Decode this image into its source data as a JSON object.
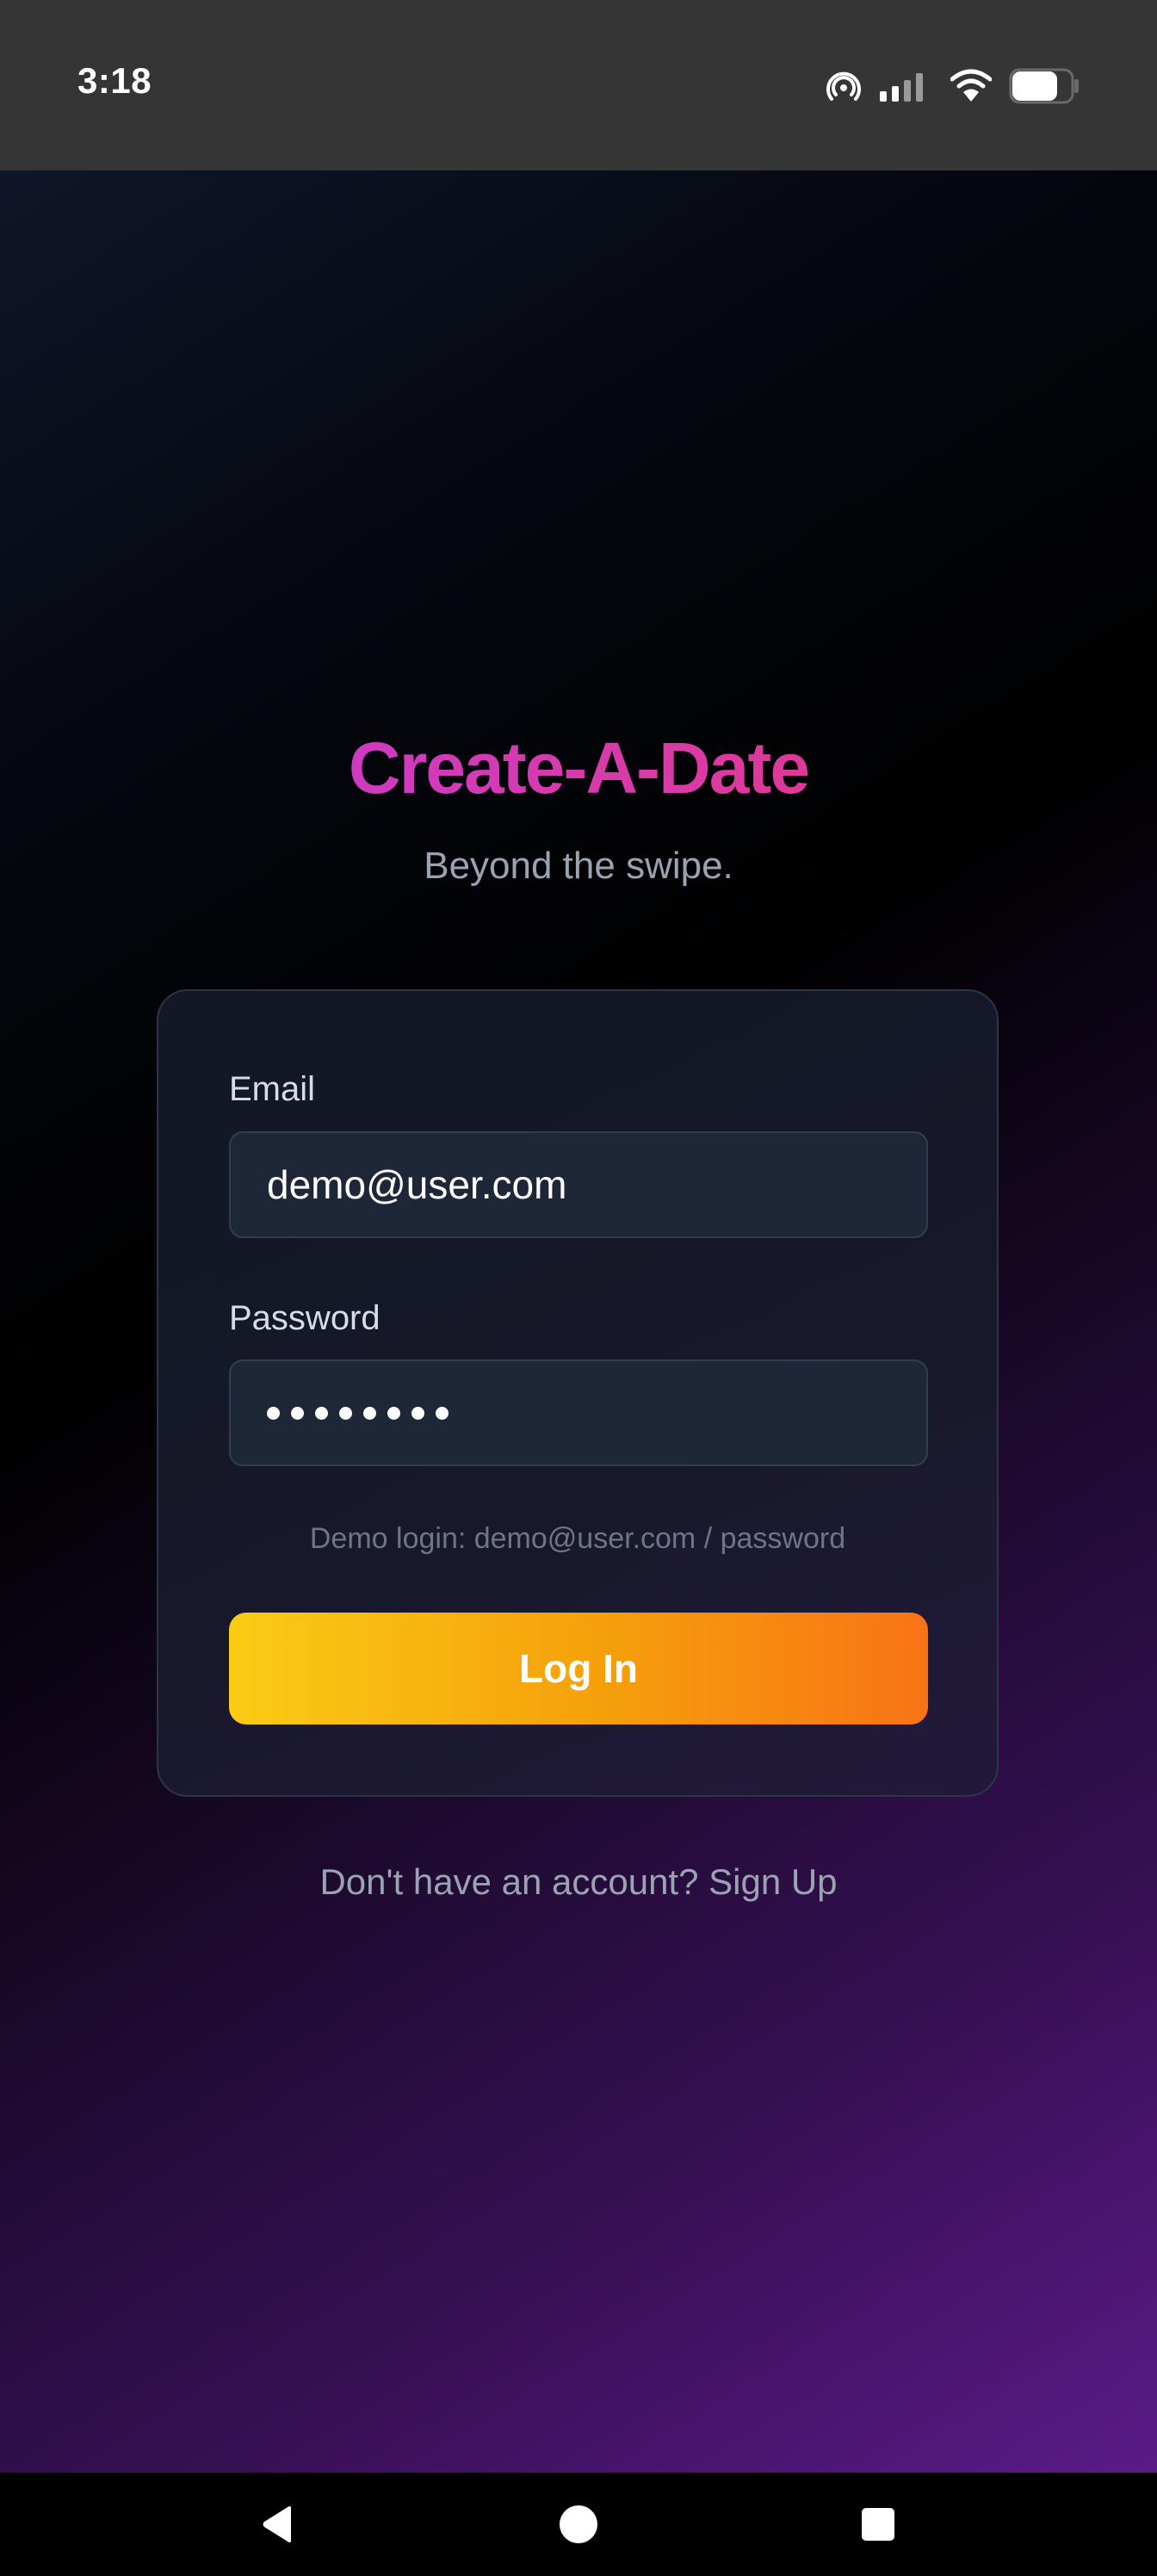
{
  "status_bar": {
    "time": "3:18",
    "icons": [
      "hotspot-icon",
      "signal-icon",
      "wifi-icon",
      "battery-icon"
    ]
  },
  "brand": {
    "title": "Create-A-Date",
    "tagline": "Beyond the swipe."
  },
  "login_form": {
    "email_label": "Email",
    "email_value": "demo@user.com",
    "password_label": "Password",
    "password_length": 8,
    "demo_hint": "Demo login: demo@user.com / password",
    "submit_label": "Log In"
  },
  "signup_prompt": "Don't have an account? Sign Up",
  "colors": {
    "title_gradient": [
      "#c23ae0",
      "#e6377a"
    ],
    "button_gradient": [
      "#facc15",
      "#f97316"
    ],
    "status_bar": "#353535"
  },
  "nav_bar": {
    "icons": [
      "back-icon",
      "home-icon",
      "recents-icon"
    ]
  }
}
